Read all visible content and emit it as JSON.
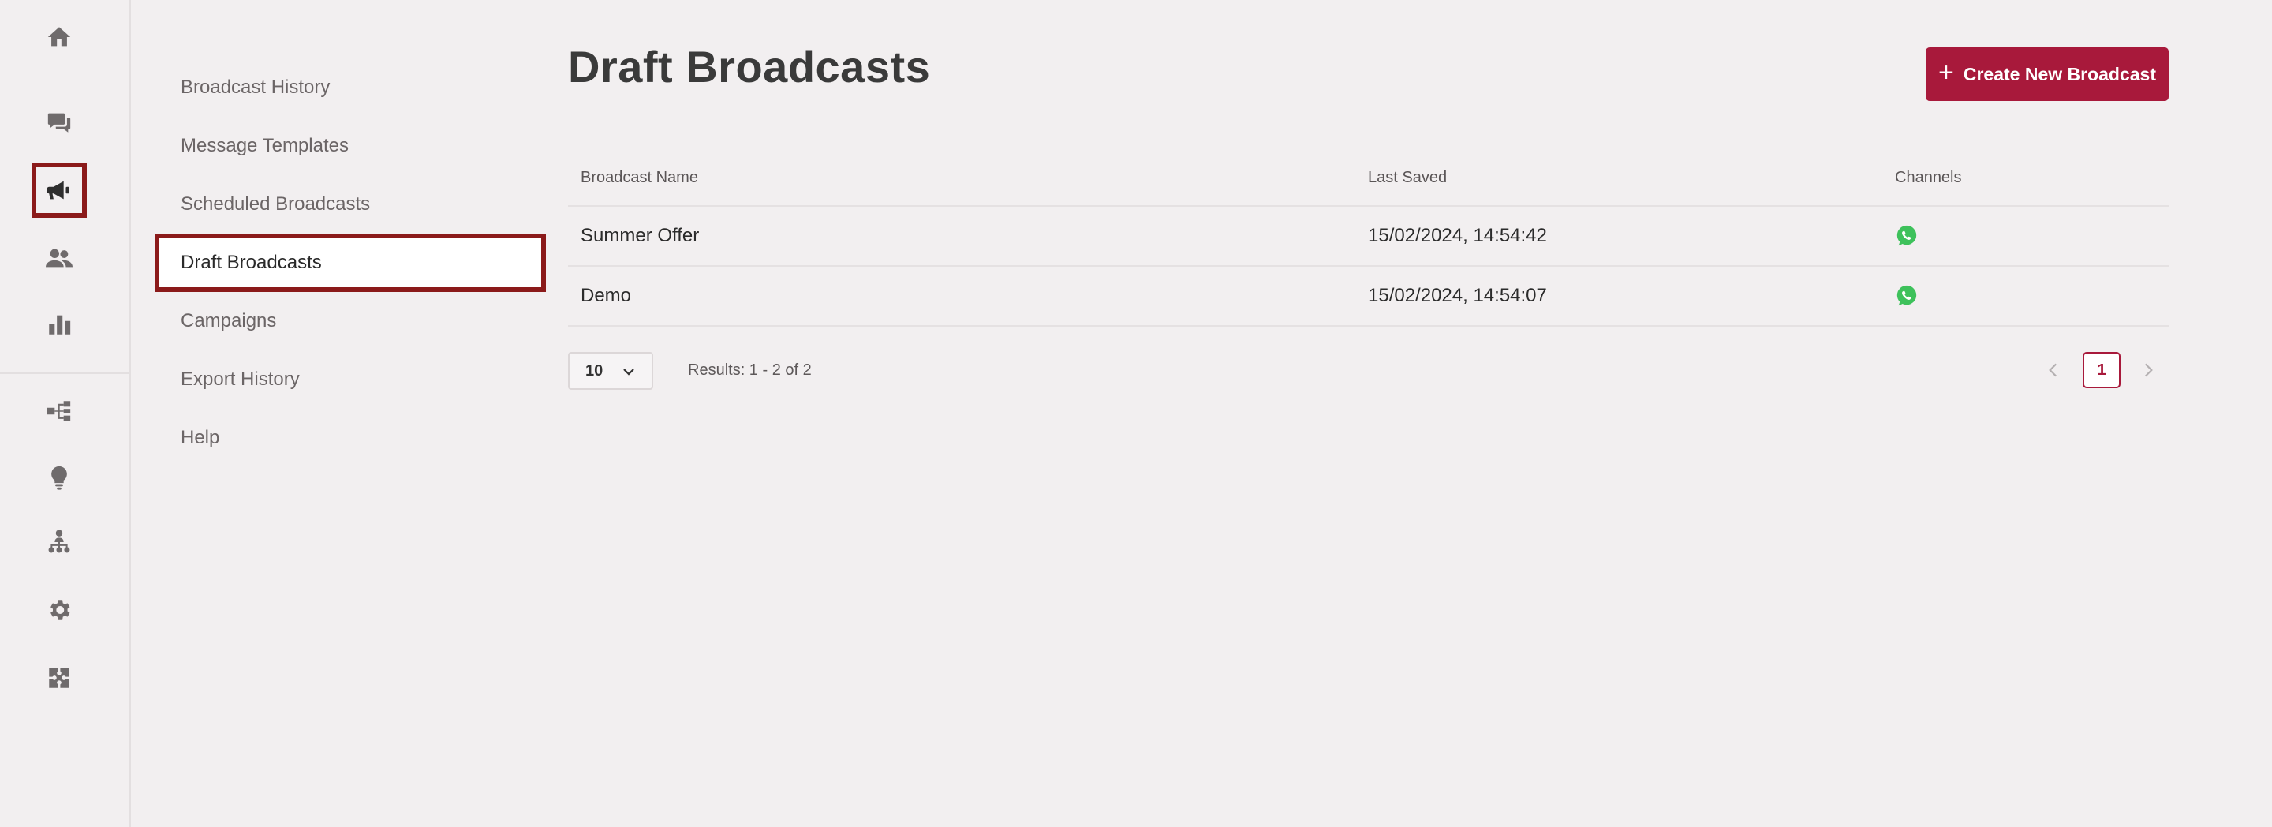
{
  "rail": {
    "items": [
      {
        "icon": "home-icon"
      },
      {
        "icon": "chat-icon"
      },
      {
        "icon": "megaphone-icon",
        "active": true
      },
      {
        "icon": "contacts-icon"
      },
      {
        "icon": "analytics-icon"
      },
      {
        "icon": "workflow-icon"
      },
      {
        "icon": "lightbulb-icon"
      },
      {
        "icon": "team-hierarchy-icon"
      },
      {
        "icon": "gear-icon"
      },
      {
        "icon": "integrations-icon"
      }
    ]
  },
  "subnav": {
    "items": [
      {
        "label": "Broadcast History"
      },
      {
        "label": "Message Templates"
      },
      {
        "label": "Scheduled Broadcasts"
      },
      {
        "label": "Draft Broadcasts",
        "active": true
      },
      {
        "label": "Campaigns"
      },
      {
        "label": "Export History"
      },
      {
        "label": "Help"
      }
    ]
  },
  "page": {
    "title": "Draft Broadcasts",
    "create_button": "Create New Broadcast"
  },
  "table": {
    "headers": [
      "Broadcast Name",
      "Last Saved",
      "Channels"
    ],
    "rows": [
      {
        "name": "Summer Offer",
        "last_saved": "15/02/2024, 14:54:42",
        "channel_icon": "whatsapp-icon"
      },
      {
        "name": "Demo",
        "last_saved": "15/02/2024, 14:54:07",
        "channel_icon": "whatsapp-icon"
      }
    ]
  },
  "pagination": {
    "page_size": "10",
    "results_text": "Results: 1 - 2 of 2",
    "current_page": "1"
  },
  "colors": {
    "accent": "#a8193b",
    "highlight_border": "#8b1a1a",
    "whatsapp": "#3ec15b"
  }
}
